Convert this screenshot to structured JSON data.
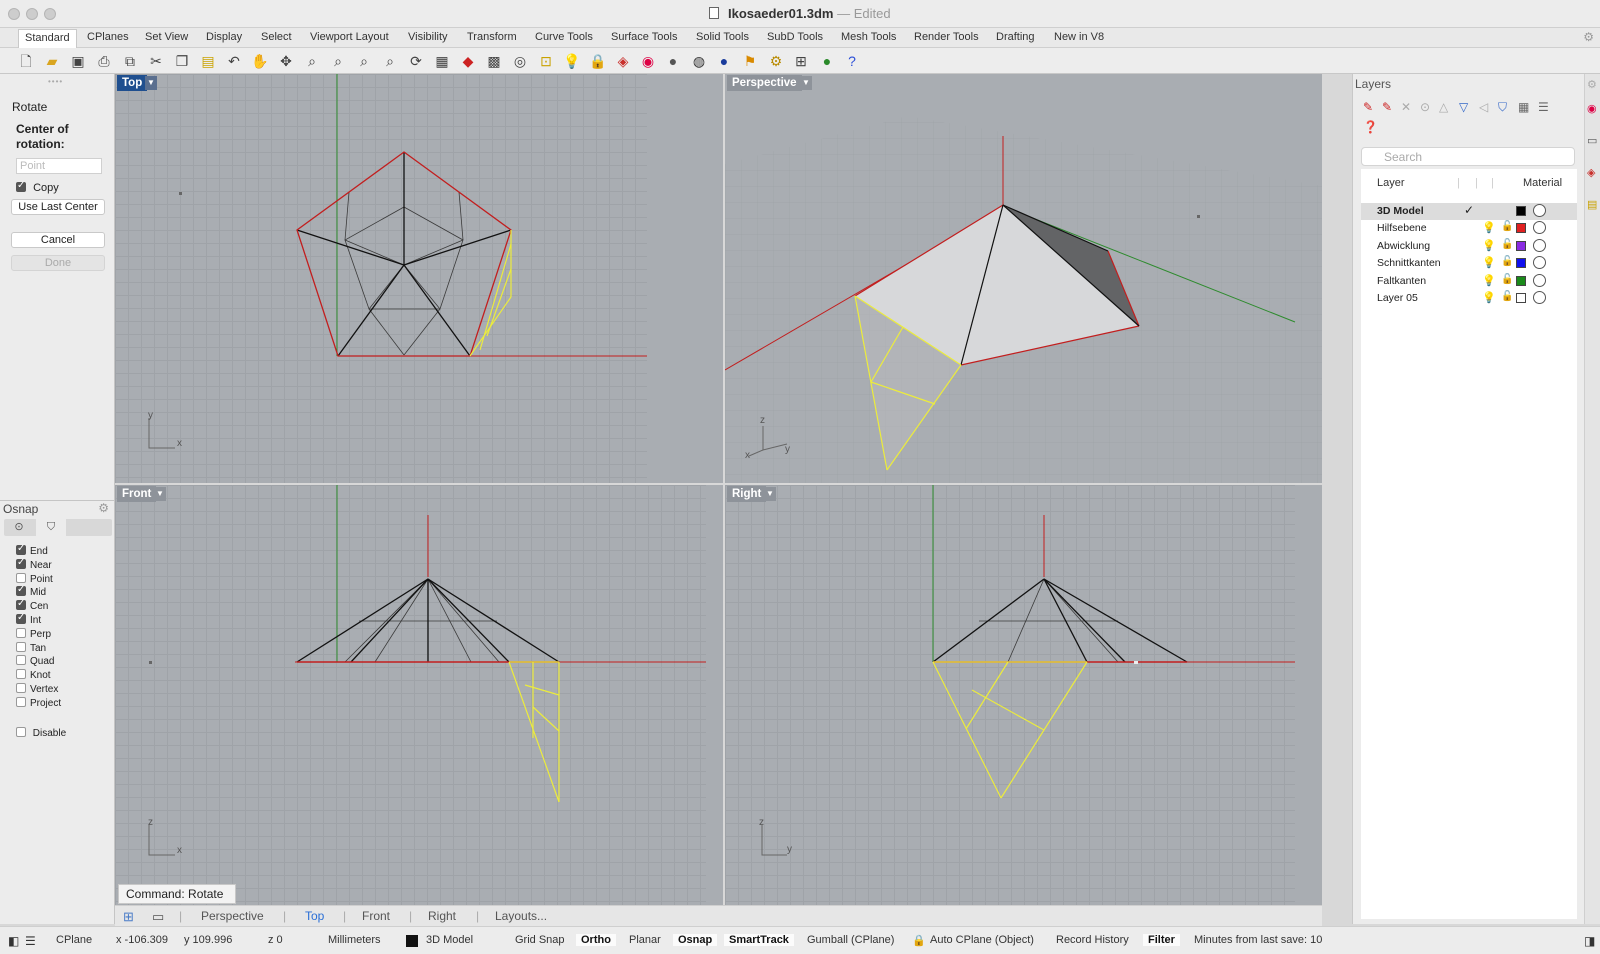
{
  "window": {
    "title": "Ikosaeder01.3dm",
    "separator": "—",
    "status": "Edited"
  },
  "tabs": [
    "Standard",
    "CPlanes",
    "Set View",
    "Display",
    "Select",
    "Viewport Layout",
    "Visibility",
    "Transform",
    "Curve Tools",
    "Surface Tools",
    "Solid Tools",
    "SubD Tools",
    "Mesh Tools",
    "Render Tools",
    "Drafting",
    "New in V8"
  ],
  "toolbar_icons": [
    "new-document-icon",
    "open-folder-icon",
    "save-icon",
    "print-icon",
    "export-icon",
    "cut-icon",
    "copy-icon",
    "paste-icon",
    "undo-icon",
    "pan-hand-icon",
    "rotate-view-icon",
    "zoom-icon",
    "zoom-window-icon",
    "zoom-extents-icon",
    "zoom-selected-icon",
    "rotate-3d-icon",
    "viewport-layout-icon",
    "car-icon",
    "mesh-grid-icon",
    "select-icon",
    "snap-icon",
    "light-icon",
    "lock-icon",
    "layer-icon",
    "color-wheel-icon",
    "sphere-icon",
    "material-icon",
    "render-icon",
    "flag-icon",
    "gear-icon",
    "cage-icon",
    "globe-icon",
    "help-icon"
  ],
  "command_panel": {
    "title": "Rotate",
    "prompt": "Center of rotation:",
    "point_placeholder": "Point",
    "copy_label": "Copy",
    "copy_checked": true,
    "use_last_center": "Use Last Center",
    "cancel": "Cancel",
    "done": "Done"
  },
  "osnap": {
    "title": "Osnap",
    "items": [
      {
        "label": "End",
        "checked": true
      },
      {
        "label": "Near",
        "checked": true
      },
      {
        "label": "Point",
        "checked": false
      },
      {
        "label": "Mid",
        "checked": true
      },
      {
        "label": "Cen",
        "checked": true
      },
      {
        "label": "Int",
        "checked": true
      },
      {
        "label": "Perp",
        "checked": false
      },
      {
        "label": "Tan",
        "checked": false
      },
      {
        "label": "Quad",
        "checked": false
      },
      {
        "label": "Knot",
        "checked": false
      },
      {
        "label": "Vertex",
        "checked": false
      },
      {
        "label": "Project",
        "checked": false
      }
    ],
    "disable": "Disable"
  },
  "viewports": {
    "top": {
      "label": "Top",
      "ax1": "y",
      "ax2": "x"
    },
    "perspective": {
      "label": "Perspective",
      "ax1": "z",
      "ax2": "y",
      "ax3": "x"
    },
    "front": {
      "label": "Front",
      "ax1": "z",
      "ax2": "x"
    },
    "right": {
      "label": "Right",
      "ax1": "z",
      "ax2": "y"
    }
  },
  "command_line": "Command: Rotate",
  "viewport_tabs": [
    "Perspective",
    "Top",
    "Front",
    "Right",
    "Layouts..."
  ],
  "active_viewport_tab": "Top",
  "layers": {
    "title": "Layers",
    "search_placeholder": "Search",
    "col_layer": "Layer",
    "col_material": "Material",
    "rows": [
      {
        "name": "3D Model",
        "current": true,
        "color": "#000000"
      },
      {
        "name": "Hilfsebene",
        "current": false,
        "color": "#e02020"
      },
      {
        "name": "Abwicklung",
        "current": false,
        "color": "#8a2be2"
      },
      {
        "name": "Schnittkanten",
        "current": false,
        "color": "#1010ee"
      },
      {
        "name": "Faltkanten",
        "current": false,
        "color": "#1a8a1a"
      },
      {
        "name": "Layer 05",
        "current": false,
        "color": "#ffffff"
      }
    ],
    "current_mark": "✓"
  },
  "status": {
    "cplane": "CPlane",
    "x": "x -106.309",
    "y": "y 109.996",
    "z": "z 0",
    "units": "Millimeters",
    "layer": "3D Model",
    "grid_snap": "Grid Snap",
    "ortho": "Ortho",
    "planar": "Planar",
    "osnap": "Osnap",
    "smarttrack": "SmartTrack",
    "gumball": "Gumball (CPlane)",
    "auto_cplane": "Auto CPlane (Object)",
    "record_history": "Record History",
    "filter": "Filter",
    "minutes": "Minutes from last save: 10"
  },
  "colors": {
    "active_viewport_label": "#1f4f8f",
    "viewport_bg": "#a9adb2",
    "edge_red": "#c21e1e",
    "edge_yellow": "#ecec3c",
    "axis_green": "#2e8b2e",
    "selected_tab": "#2a6fd6"
  }
}
